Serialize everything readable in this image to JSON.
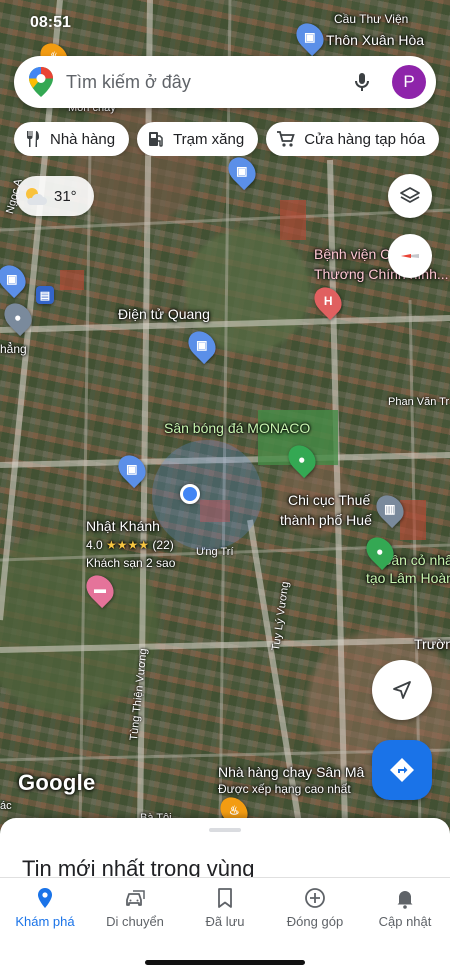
{
  "status_bar": {
    "time": "08:51"
  },
  "search": {
    "placeholder": "Tìm kiếm ở đây",
    "avatar_letter": "P"
  },
  "chips": [
    {
      "label": "Nhà hàng",
      "icon": "fork-knife-icon"
    },
    {
      "label": "Trạm xăng",
      "icon": "gas-pump-icon"
    },
    {
      "label": "Cửa hàng tạp hóa",
      "icon": "cart-icon"
    }
  ],
  "weather": {
    "temperature": "31°",
    "icon": "partly-cloudy-icon"
  },
  "map": {
    "labels": {
      "thon_xuan_hoa": "Thôn Xuân Hòa",
      "cau_thu_vien": "Cầu Thư Viện",
      "benh_vien": "Bệnh viện C",
      "benh_vien_sub": "Thương Chính hình...",
      "dien_tu_quang": "Điện tử Quang",
      "san_bong": "Sân bóng đá MONACO",
      "chi_cuc_thue": "Chi cục Thuế",
      "chi_cuc_thue_sub": "thành phố Huế",
      "nhat_khanh": "Nhật Khánh",
      "nhat_khanh_rating": "4.0",
      "nhat_khanh_reviews": "(22)",
      "nhat_khanh_type": "Khách sạn 2 sao",
      "san_co": "Sân cỏ nhâ",
      "san_co_sub": "tạo Lâm Hoàn",
      "nha_hang_chay": "Nhà hàng chay Sân Mâ",
      "nha_hang_chay_sub": "Được xếp hạng cao nhất",
      "truong": "Trườn",
      "ngoc_a": "Ngọc A",
      "phan_van_tr": "Phan Văn Tr",
      "ung_tri": "Ưng Trí",
      "tuy_ly_vuong": "Tuy Lý Vương",
      "tung_thien_vuong": "Tùng Thiện Vương",
      "mon_chay": "Món chay",
      "hang": "hẳng",
      "cac": "ác",
      "ba_toi": "Bà Tôi"
    },
    "google_logo": "Google"
  },
  "sheet": {
    "title": "Tin mới nhất trong vùng"
  },
  "bottom_nav": [
    {
      "label": "Khám phá",
      "icon": "explore-pin-icon",
      "active": true
    },
    {
      "label": "Di chuyển",
      "icon": "car-icon",
      "active": false
    },
    {
      "label": "Đã lưu",
      "icon": "bookmark-icon",
      "active": false
    },
    {
      "label": "Đóng góp",
      "icon": "plus-circle-icon",
      "active": false
    },
    {
      "label": "Cập nhật",
      "icon": "bell-icon",
      "active": false
    }
  ],
  "colors": {
    "accent": "#1a73e8",
    "avatar": "#8e24aa",
    "location_dot": "#4285f4"
  }
}
